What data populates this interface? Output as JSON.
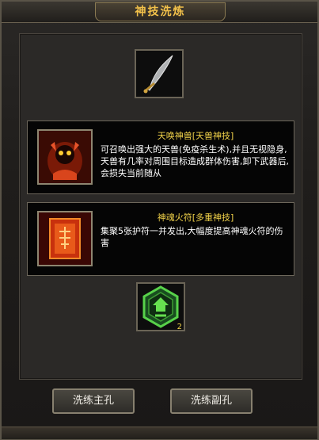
{
  "window": {
    "title": "神技洗炼"
  },
  "skills": [
    {
      "name": "天唤神兽[天兽神技]",
      "description": "可召唤出强大的天兽(免疫杀生术),并且无视隐身,天兽有几率对周围目标造成群体伤害,卸下武器后,会损失当前随从"
    },
    {
      "name": "神魂火符[多重神技]",
      "description": "集聚5张护符一并发出,大幅度提高神魂火符的伤害"
    }
  ],
  "rune": {
    "count": "2"
  },
  "buttons": {
    "wash_main": "洗练主孔",
    "wash_sub": "洗练副孔"
  }
}
